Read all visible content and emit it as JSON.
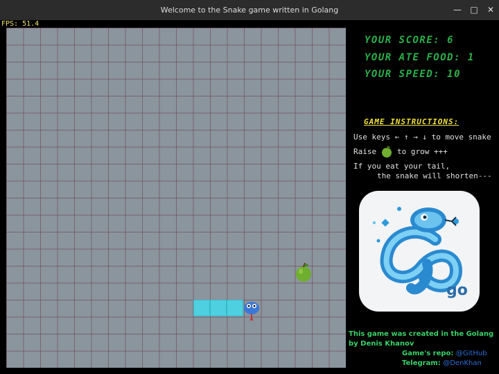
{
  "window": {
    "title": "Welcome to the Snake game written in Golang"
  },
  "fps": "FPS: 51.4",
  "stats": {
    "score": "YOUR SCORE: 6",
    "food": "YOUR ATE FOOD: 1",
    "speed": "YOUR SPEED: 10"
  },
  "instructions": {
    "title": "GAME INSTRUCTIONS:",
    "line1": "Use keys ← ↑ → ↓ to move snake",
    "line2_pre": "Raise",
    "line2_post": "to grow +++",
    "line3": "If you eat your tail,",
    "line4": "the snake will shorten---"
  },
  "logo": {
    "text": "go"
  },
  "credits": {
    "line1": "This game  was created in the Golang",
    "line2": "by Denis Khanov",
    "repo_label": "Game's repo:",
    "repo_link": "@GitHub",
    "telegram_label": "Telegram:",
    "telegram_link": "@DenKhan"
  },
  "colors": {
    "board": "#8a959e",
    "snake": "#4fd0e0",
    "score_text": "#2bb048",
    "instructions_title": "#f0e040"
  }
}
